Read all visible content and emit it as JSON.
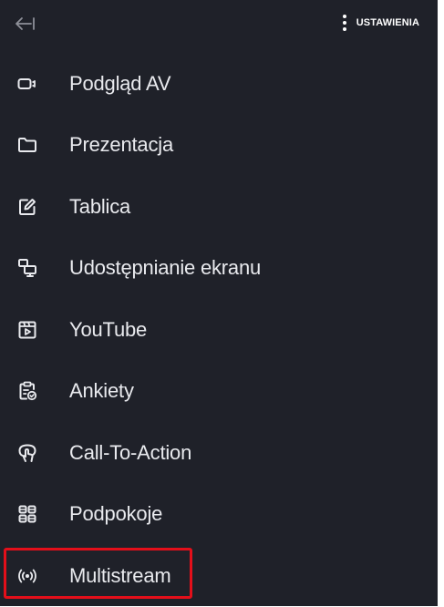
{
  "header": {
    "back_icon": "arrow-left-to-line-icon",
    "settings_icon": "more-vertical-icon",
    "settings_label": "USTAWIENIA"
  },
  "menu": {
    "items": [
      {
        "label": "Podgląd AV",
        "icon": "camera-icon"
      },
      {
        "label": "Prezentacja",
        "icon": "folder-icon"
      },
      {
        "label": "Tablica",
        "icon": "edit-square-icon"
      },
      {
        "label": "Udostępnianie ekranu",
        "icon": "screen-share-icon"
      },
      {
        "label": "YouTube",
        "icon": "video-play-icon"
      },
      {
        "label": "Ankiety",
        "icon": "clipboard-check-icon"
      },
      {
        "label": "Call-To-Action",
        "icon": "hand-pointer-icon"
      },
      {
        "label": "Podpokoje",
        "icon": "grid-rooms-icon"
      },
      {
        "label": "Multistream",
        "icon": "broadcast-icon"
      }
    ]
  },
  "highlight": {
    "target": "Multistream",
    "color": "#e30f1a"
  },
  "colors": {
    "panel_background": "#1f2129",
    "text": "#e9eaee",
    "highlight_border": "#e30f1a"
  }
}
